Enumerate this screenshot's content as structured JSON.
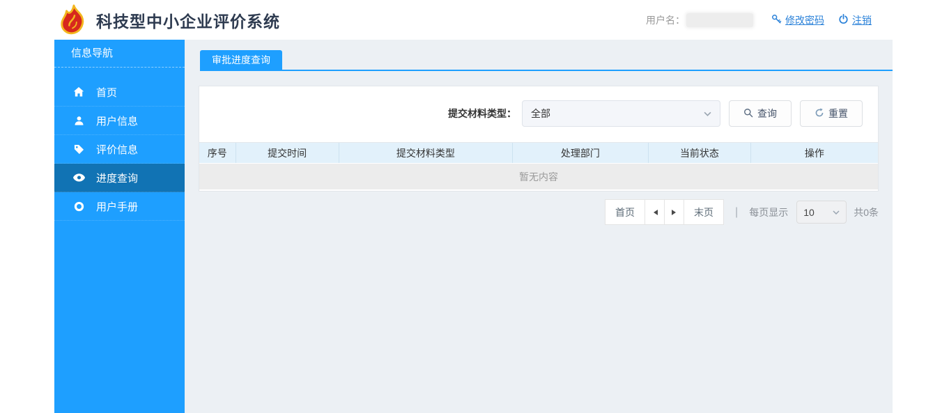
{
  "header": {
    "title": "科技型中小企业评价系统",
    "username_label": "用户名：",
    "change_password_label": "修改密码",
    "logout_label": "注销"
  },
  "sidebar": {
    "title": "信息导航",
    "items": [
      {
        "label": "首页",
        "icon": "home-icon",
        "active": false
      },
      {
        "label": "用户信息",
        "icon": "user-icon",
        "active": false
      },
      {
        "label": "评价信息",
        "icon": "tag-icon",
        "active": false
      },
      {
        "label": "进度查询",
        "icon": "eye-icon",
        "active": true
      },
      {
        "label": "用户手册",
        "icon": "ring-icon",
        "active": false
      }
    ]
  },
  "main": {
    "tab_label": "审批进度查询",
    "filter": {
      "material_type_label": "提交材料类型：",
      "material_type_selected": "全部",
      "search_button": "查询",
      "reset_button": "重置"
    },
    "table": {
      "columns": [
        "序号",
        "提交时间",
        "提交材料类型",
        "处理部门",
        "当前状态",
        "操作"
      ],
      "rows": [],
      "empty_text": "暂无内容"
    },
    "pagination": {
      "first_label": "首页",
      "last_label": "末页",
      "separator": "|",
      "per_page_label": "每页显示",
      "per_page_value": "10",
      "total_label": "共0条"
    }
  },
  "colors": {
    "sidebar_blue": "#1e9fff",
    "sidebar_active_blue": "#1173b4",
    "tab_blue": "#1e9fff",
    "link_blue": "#2b82d9",
    "table_header_bg": "#e2f1fb",
    "title_color": "#2e3b50",
    "content_bg": "#ecf0f4"
  }
}
